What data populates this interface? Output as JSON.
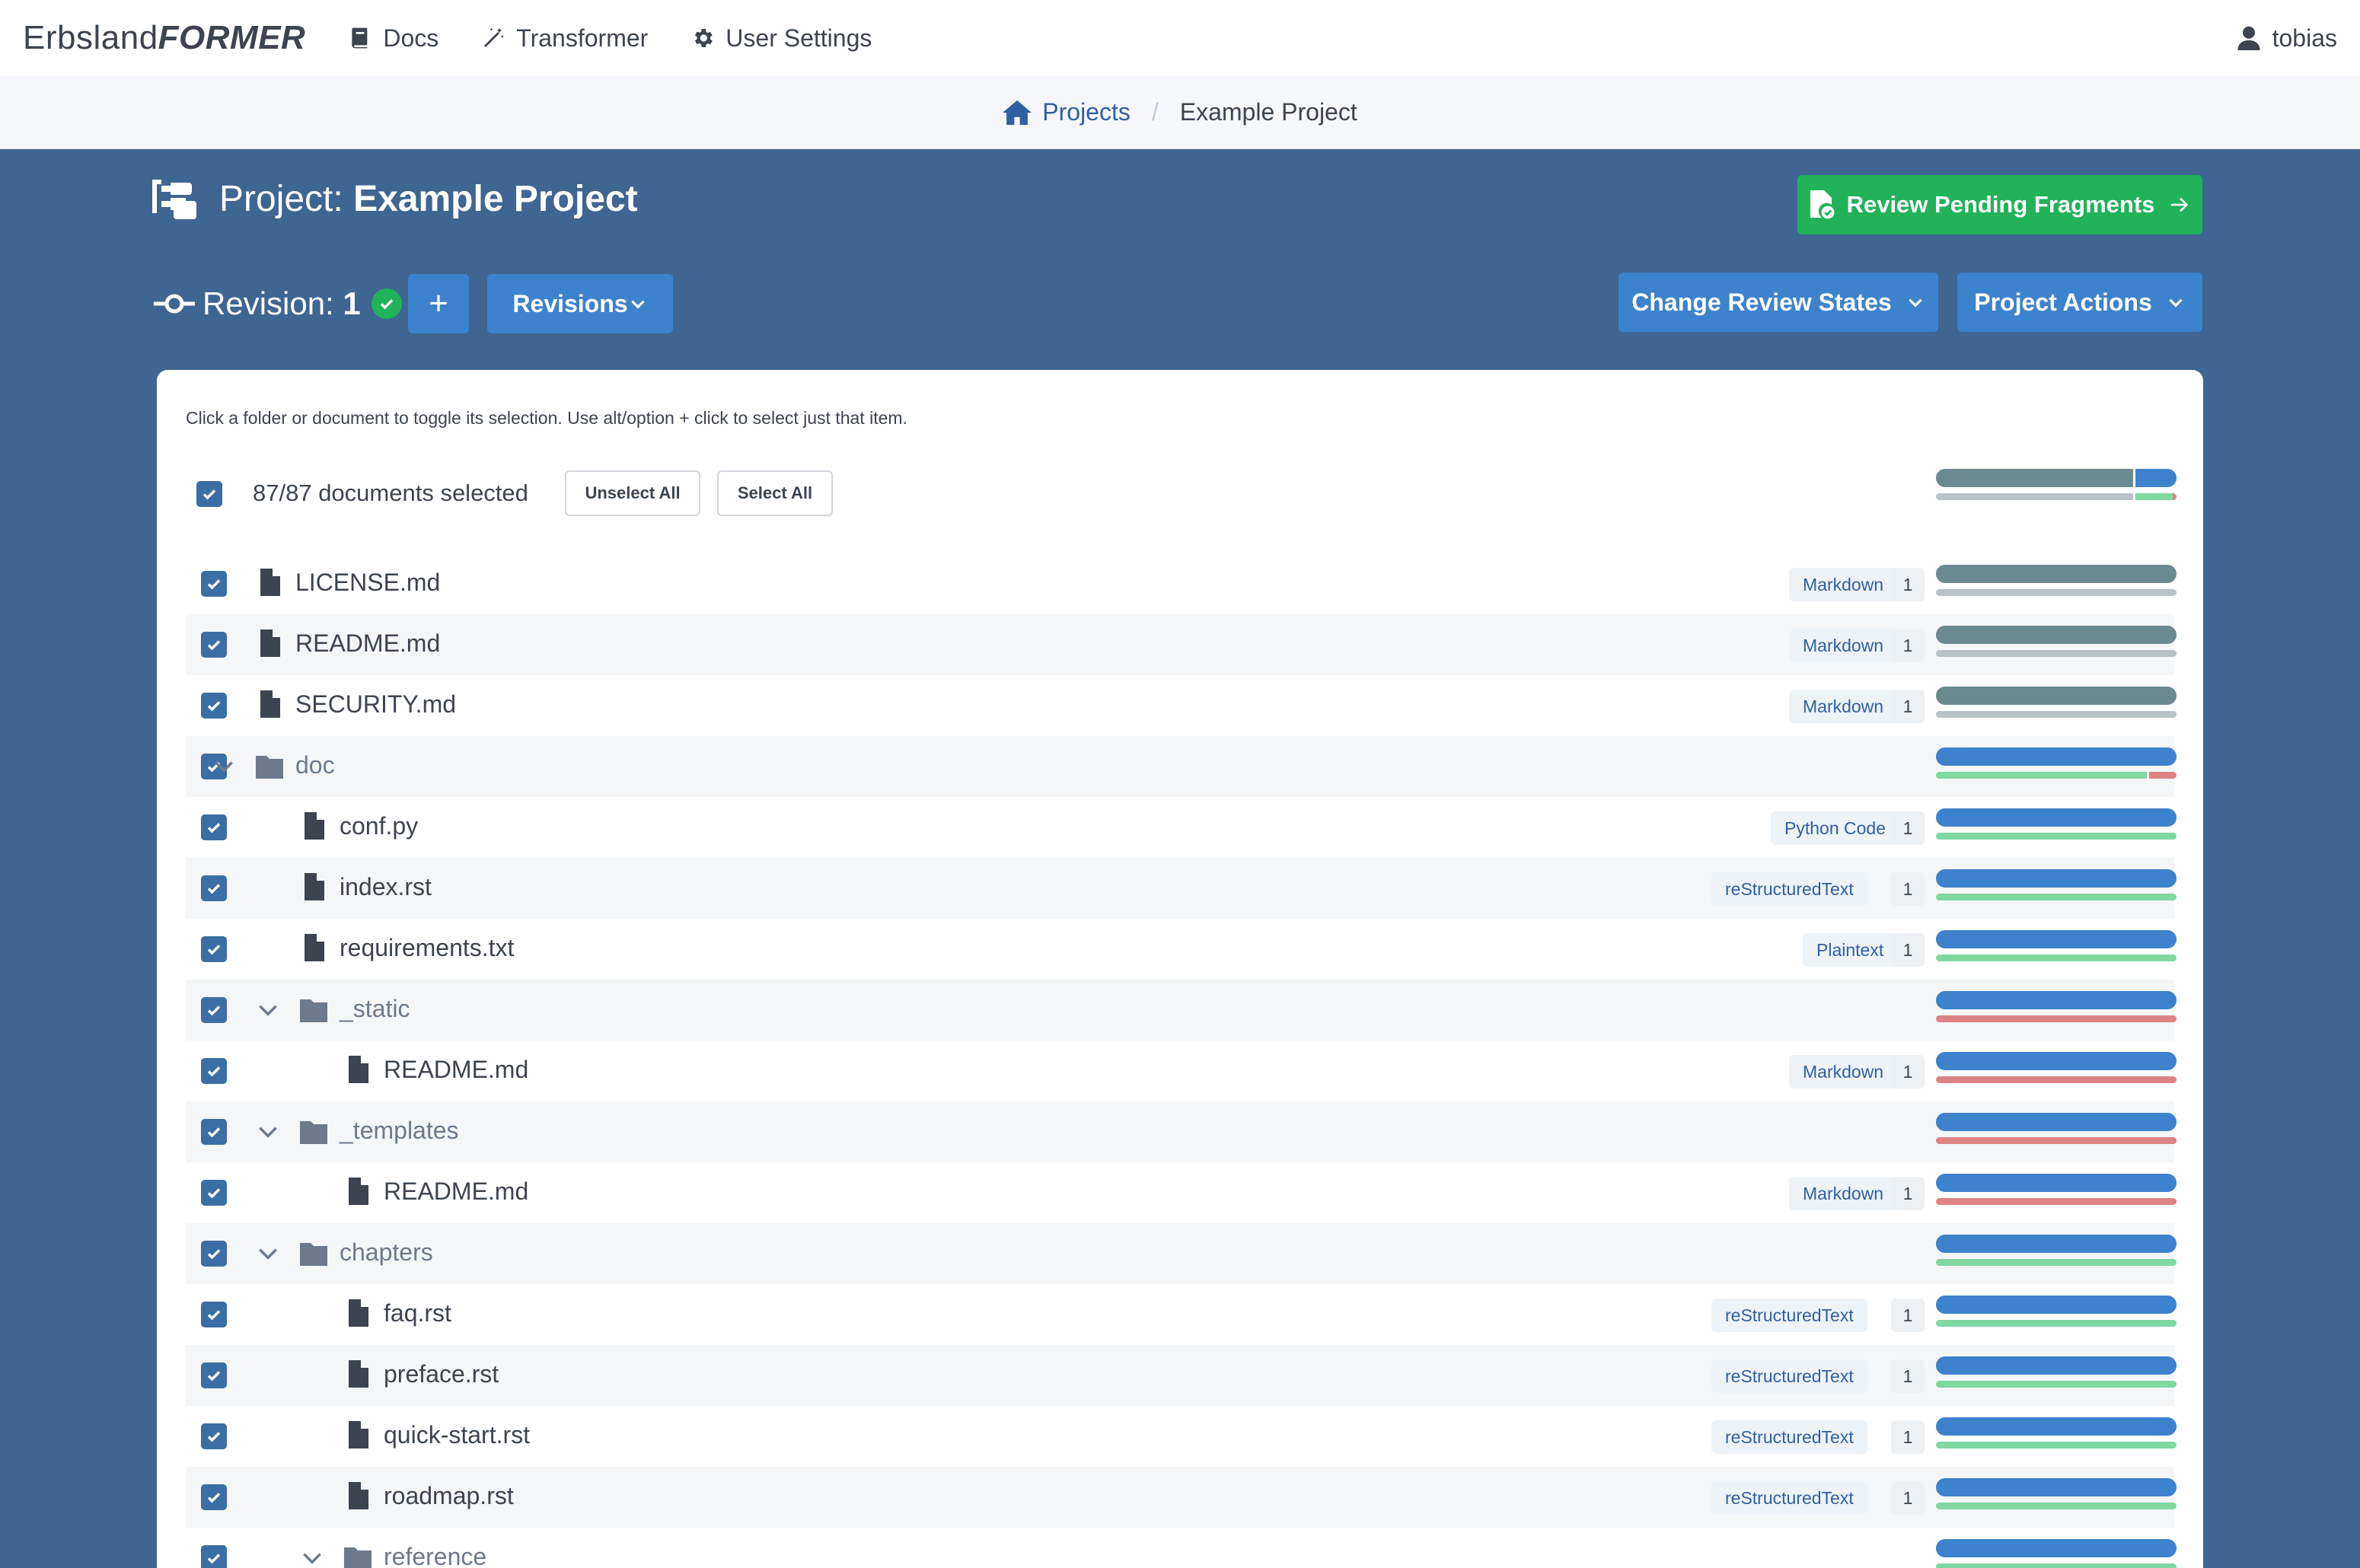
{
  "nav": {
    "brand_light": "Erbsland",
    "brand_bold": "FORMER",
    "docs": "Docs",
    "transformer": "Transformer",
    "user_settings": "User Settings",
    "user": "tobias"
  },
  "breadcrumb": {
    "home": "Projects",
    "separator": "/",
    "current": "Example Project"
  },
  "project": {
    "label": "Project:",
    "name": "Example Project",
    "review_button": "Review Pending Fragments",
    "revision_label": "Revision:",
    "revision_number": "1",
    "add_button": "+",
    "revisions_button": "Revisions",
    "change_review_states": "Change Review States",
    "project_actions": "Project Actions"
  },
  "colors": {
    "primary": "#3d82cc",
    "success": "#21b25a",
    "header_bg": "#3f6592",
    "neutral": "#6a8a8f",
    "green_line": "#7ed8a0",
    "red_line": "#de8383"
  },
  "card": {
    "hint": "Click a folder or document to toggle its selection. Use alt/option + click to select just that item.",
    "selection": "87/87 documents selected",
    "unselect_all": "Unselect All",
    "select_all": "Select All"
  },
  "items": [
    {
      "type": "file",
      "name": "LICENSE.md",
      "tag": "Markdown",
      "count": "1",
      "status": "gray"
    },
    {
      "type": "file",
      "name": "README.md",
      "tag": "Markdown",
      "count": "1",
      "status": "gray"
    },
    {
      "type": "file",
      "name": "SECURITY.md",
      "tag": "Markdown",
      "count": "1",
      "status": "gray"
    },
    {
      "type": "folder",
      "name": "doc",
      "status": "blue_mixed"
    },
    {
      "type": "file",
      "name": "conf.py",
      "tag": "Python Code",
      "count": "1",
      "status": "blue_green"
    },
    {
      "type": "file",
      "name": "index.rst",
      "tag": "reStructuredText",
      "count": "1",
      "status": "blue_green"
    },
    {
      "type": "file",
      "name": "requirements.txt",
      "tag": "Plaintext",
      "count": "1",
      "status": "blue_green"
    },
    {
      "type": "folder",
      "name": "_static",
      "status": "blue_red"
    },
    {
      "type": "file",
      "name": "README.md",
      "tag": "Markdown",
      "count": "1",
      "status": "blue_red"
    },
    {
      "type": "folder",
      "name": "_templates",
      "status": "blue_red"
    },
    {
      "type": "file",
      "name": "README.md",
      "tag": "Markdown",
      "count": "1",
      "status": "blue_red"
    },
    {
      "type": "folder",
      "name": "chapters",
      "status": "blue_green"
    },
    {
      "type": "file",
      "name": "faq.rst",
      "tag": "reStructuredText",
      "count": "1",
      "status": "blue_green"
    },
    {
      "type": "file",
      "name": "preface.rst",
      "tag": "reStructuredText",
      "count": "1",
      "status": "blue_green"
    },
    {
      "type": "file",
      "name": "quick-start.rst",
      "tag": "reStructuredText",
      "count": "1",
      "status": "blue_green"
    },
    {
      "type": "file",
      "name": "roadmap.rst",
      "tag": "reStructuredText",
      "count": "1",
      "status": "blue_green"
    },
    {
      "type": "folder",
      "name": "reference",
      "status": "blue_green"
    }
  ]
}
